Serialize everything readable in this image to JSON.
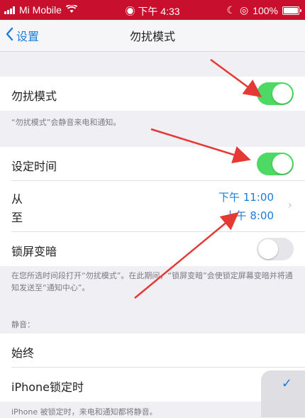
{
  "status": {
    "carrier": "Mi Mobile",
    "time": "下午 4:33",
    "battery": "100%"
  },
  "nav": {
    "back_label": "设置",
    "title": "勿扰模式"
  },
  "dnd": {
    "label": "勿扰模式",
    "enabled": true,
    "footnote": "“勿扰模式”会静音来电和通知。"
  },
  "schedule": {
    "label": "设定时间",
    "enabled": true,
    "from_label": "从",
    "to_label": "至",
    "from_time": "下午 11:00",
    "to_time": "上午 8:00"
  },
  "dim_lock": {
    "label": "锁屏变暗",
    "enabled": false,
    "footnote": "在您所选时间段打开“勿扰模式”。在此期间，“锁屏变暗”会使锁定屏幕变暗并将通知发送至“通知中心”。"
  },
  "silence": {
    "header": "静音：",
    "always_label": "始终",
    "locked_label": "iPhone锁定时",
    "locked_footnote": "iPhone 被锁定时，来电和通知都将静音。"
  },
  "colors": {
    "accent": "#1a7ddb",
    "toggle_on": "#4cd964",
    "status_bar": "#c8102e",
    "arrow": "#e53935"
  }
}
